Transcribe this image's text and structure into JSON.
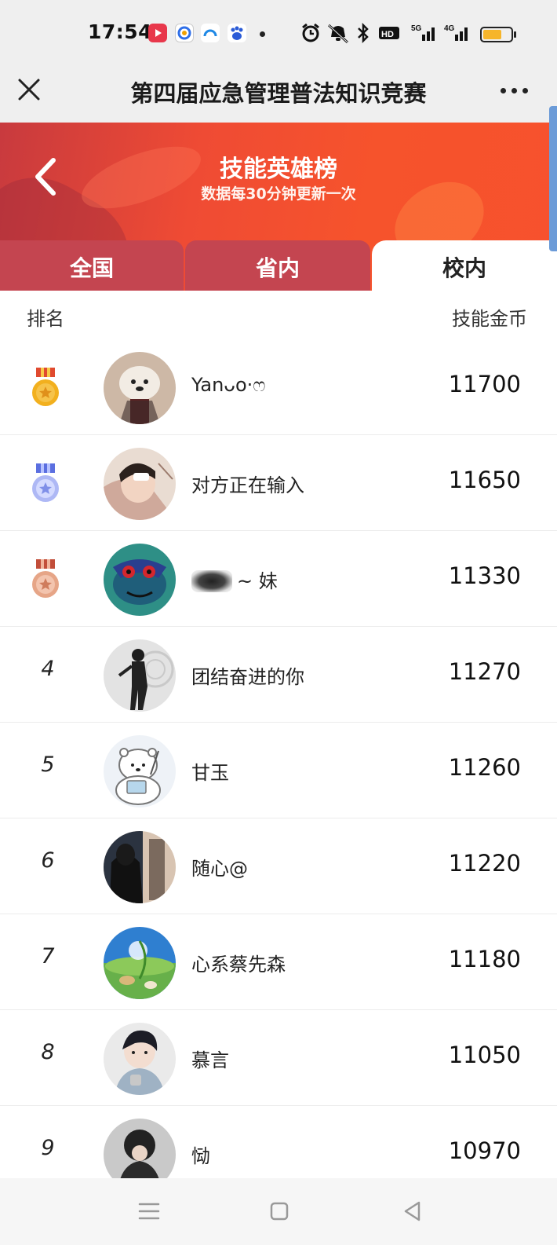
{
  "status_bar": {
    "time": "17:54",
    "app_icons": [
      "video-app-icon",
      "browser-app-icon",
      "cloud-app-icon",
      "baidu-app-icon"
    ],
    "system_icons": [
      "alarm-icon",
      "mute-icon",
      "bluetooth-icon",
      "hd-icon",
      "signal-5g-icon",
      "signal-4g-icon",
      "battery-icon"
    ],
    "battery_level": 0.6
  },
  "title_bar": {
    "title": "第四届应急管理普法知识竞赛"
  },
  "hero": {
    "title": "技能英雄榜",
    "subtitle": "数据每30分钟更新一次"
  },
  "tabs": [
    {
      "label": "全国",
      "active": false
    },
    {
      "label": "省内",
      "active": false
    },
    {
      "label": "校内",
      "active": true
    }
  ],
  "list_header": {
    "rank_label": "排名",
    "coins_label": "技能金币"
  },
  "rows": [
    {
      "rank": "1",
      "medal": "gold",
      "name": "Yanᴗo·ෆ",
      "score": "11700"
    },
    {
      "rank": "2",
      "medal": "silver",
      "name": "对方正在输入",
      "score": "11650"
    },
    {
      "rank": "3",
      "medal": "bronze",
      "name": "~ 妹",
      "score": "11330"
    },
    {
      "rank": "4",
      "medal": null,
      "name": "团结奋进的你",
      "score": "11270"
    },
    {
      "rank": "5",
      "medal": null,
      "name": "甘玉",
      "score": "11260"
    },
    {
      "rank": "6",
      "medal": null,
      "name": "随心@",
      "score": "11220"
    },
    {
      "rank": "7",
      "medal": null,
      "name": "心系蔡先森",
      "score": "11180"
    },
    {
      "rank": "8",
      "medal": null,
      "name": "慕言",
      "score": "11050"
    },
    {
      "rank": "9",
      "medal": null,
      "name": "恸",
      "score": "10970"
    }
  ],
  "colors": {
    "hero_red": "#f6532c",
    "tab_inactive": "#c44550",
    "gold": "#f2b01e",
    "silver": "#8f9cf0",
    "bronze": "#d98b68"
  }
}
